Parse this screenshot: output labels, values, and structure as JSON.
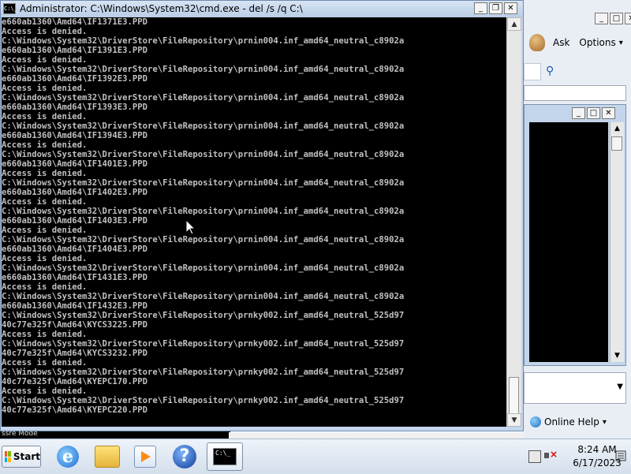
{
  "window": {
    "title": "Administrator: C:\\Windows\\System32\\cmd.exe - del  /s /q C:\\",
    "icon_text": "C:\\_"
  },
  "console": {
    "lines": [
      "e660ab1360\\Amd64\\IF1371E3.PPD",
      "Access is denied.",
      "C:\\Windows\\System32\\DriverStore\\FileRepository\\prnin004.inf_amd64_neutral_c8902a",
      "e660ab1360\\Amd64\\IF1391E3.PPD",
      "Access is denied.",
      "C:\\Windows\\System32\\DriverStore\\FileRepository\\prnin004.inf_amd64_neutral_c8902a",
      "e660ab1360\\Amd64\\IF1392E3.PPD",
      "Access is denied.",
      "C:\\Windows\\System32\\DriverStore\\FileRepository\\prnin004.inf_amd64_neutral_c8902a",
      "e660ab1360\\Amd64\\IF1393E3.PPD",
      "Access is denied.",
      "C:\\Windows\\System32\\DriverStore\\FileRepository\\prnin004.inf_amd64_neutral_c8902a",
      "e660ab1360\\Amd64\\IF1394E3.PPD",
      "Access is denied.",
      "C:\\Windows\\System32\\DriverStore\\FileRepository\\prnin004.inf_amd64_neutral_c8902a",
      "e660ab1360\\Amd64\\IF1401E3.PPD",
      "Access is denied.",
      "C:\\Windows\\System32\\DriverStore\\FileRepository\\prnin004.inf_amd64_neutral_c8902a",
      "e660ab1360\\Amd64\\IF1402E3.PPD",
      "Access is denied.",
      "C:\\Windows\\System32\\DriverStore\\FileRepository\\prnin004.inf_amd64_neutral_c8902a",
      "e660ab1360\\Amd64\\IF1403E3.PPD",
      "Access is denied.",
      "C:\\Windows\\System32\\DriverStore\\FileRepository\\prnin004.inf_amd64_neutral_c8902a",
      "e660ab1360\\Amd64\\IF1404E3.PPD",
      "Access is denied.",
      "C:\\Windows\\System32\\DriverStore\\FileRepository\\prnin004.inf_amd64_neutral_c8902a",
      "e660ab1360\\Amd64\\IF1431E3.PPD",
      "Access is denied.",
      "C:\\Windows\\System32\\DriverStore\\FileRepository\\prnin004.inf_amd64_neutral_c8902a",
      "e660ab1360\\Amd64\\IF1432E3.PPD",
      "C:\\Windows\\System32\\DriverStore\\FileRepository\\prnky002.inf_amd64_neutral_525d97",
      "40c77e325f\\Amd64\\KYCS3225.PPD",
      "Access is denied.",
      "C:\\Windows\\System32\\DriverStore\\FileRepository\\prnky002.inf_amd64_neutral_525d97",
      "40c77e325f\\Amd64\\KYCS3232.PPD",
      "Access is denied.",
      "C:\\Windows\\System32\\DriverStore\\FileRepository\\prnky002.inf_amd64_neutral_525d97",
      "40c77e325f\\Amd64\\KYEPC170.PPD",
      "Access is denied.",
      "C:\\Windows\\System32\\DriverStore\\FileRepository\\prnky002.inf_amd64_neutral_525d97",
      "40c77e325f\\Amd64\\KYEPC220.PPD"
    ],
    "text_color": "#c0c0c0",
    "background": "#000000"
  },
  "background_window": {
    "ask_label": "Ask",
    "options_label": "Options",
    "online_help_label": "Online Help"
  },
  "status_strip": "ssre Mode",
  "taskbar": {
    "start_label": "Start",
    "clock_time": "8:24 AM",
    "clock_date": "6/17/2023"
  }
}
